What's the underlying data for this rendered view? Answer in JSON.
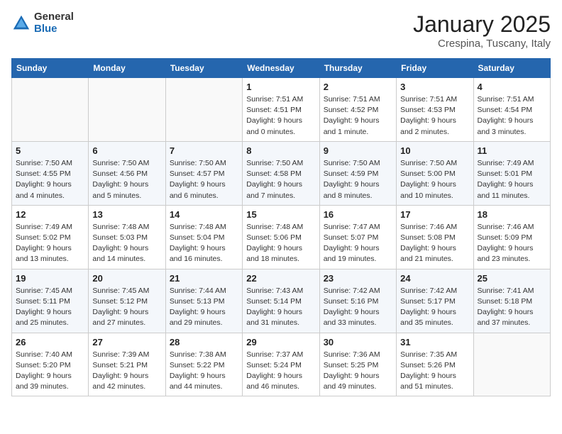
{
  "logo": {
    "general": "General",
    "blue": "Blue"
  },
  "title": "January 2025",
  "subtitle": "Crespina, Tuscany, Italy",
  "days_of_week": [
    "Sunday",
    "Monday",
    "Tuesday",
    "Wednesday",
    "Thursday",
    "Friday",
    "Saturday"
  ],
  "weeks": [
    [
      {
        "day": "",
        "info": ""
      },
      {
        "day": "",
        "info": ""
      },
      {
        "day": "",
        "info": ""
      },
      {
        "day": "1",
        "info": "Sunrise: 7:51 AM\nSunset: 4:51 PM\nDaylight: 9 hours\nand 0 minutes."
      },
      {
        "day": "2",
        "info": "Sunrise: 7:51 AM\nSunset: 4:52 PM\nDaylight: 9 hours\nand 1 minute."
      },
      {
        "day": "3",
        "info": "Sunrise: 7:51 AM\nSunset: 4:53 PM\nDaylight: 9 hours\nand 2 minutes."
      },
      {
        "day": "4",
        "info": "Sunrise: 7:51 AM\nSunset: 4:54 PM\nDaylight: 9 hours\nand 3 minutes."
      }
    ],
    [
      {
        "day": "5",
        "info": "Sunrise: 7:50 AM\nSunset: 4:55 PM\nDaylight: 9 hours\nand 4 minutes."
      },
      {
        "day": "6",
        "info": "Sunrise: 7:50 AM\nSunset: 4:56 PM\nDaylight: 9 hours\nand 5 minutes."
      },
      {
        "day": "7",
        "info": "Sunrise: 7:50 AM\nSunset: 4:57 PM\nDaylight: 9 hours\nand 6 minutes."
      },
      {
        "day": "8",
        "info": "Sunrise: 7:50 AM\nSunset: 4:58 PM\nDaylight: 9 hours\nand 7 minutes."
      },
      {
        "day": "9",
        "info": "Sunrise: 7:50 AM\nSunset: 4:59 PM\nDaylight: 9 hours\nand 8 minutes."
      },
      {
        "day": "10",
        "info": "Sunrise: 7:50 AM\nSunset: 5:00 PM\nDaylight: 9 hours\nand 10 minutes."
      },
      {
        "day": "11",
        "info": "Sunrise: 7:49 AM\nSunset: 5:01 PM\nDaylight: 9 hours\nand 11 minutes."
      }
    ],
    [
      {
        "day": "12",
        "info": "Sunrise: 7:49 AM\nSunset: 5:02 PM\nDaylight: 9 hours\nand 13 minutes."
      },
      {
        "day": "13",
        "info": "Sunrise: 7:48 AM\nSunset: 5:03 PM\nDaylight: 9 hours\nand 14 minutes."
      },
      {
        "day": "14",
        "info": "Sunrise: 7:48 AM\nSunset: 5:04 PM\nDaylight: 9 hours\nand 16 minutes."
      },
      {
        "day": "15",
        "info": "Sunrise: 7:48 AM\nSunset: 5:06 PM\nDaylight: 9 hours\nand 18 minutes."
      },
      {
        "day": "16",
        "info": "Sunrise: 7:47 AM\nSunset: 5:07 PM\nDaylight: 9 hours\nand 19 minutes."
      },
      {
        "day": "17",
        "info": "Sunrise: 7:46 AM\nSunset: 5:08 PM\nDaylight: 9 hours\nand 21 minutes."
      },
      {
        "day": "18",
        "info": "Sunrise: 7:46 AM\nSunset: 5:09 PM\nDaylight: 9 hours\nand 23 minutes."
      }
    ],
    [
      {
        "day": "19",
        "info": "Sunrise: 7:45 AM\nSunset: 5:11 PM\nDaylight: 9 hours\nand 25 minutes."
      },
      {
        "day": "20",
        "info": "Sunrise: 7:45 AM\nSunset: 5:12 PM\nDaylight: 9 hours\nand 27 minutes."
      },
      {
        "day": "21",
        "info": "Sunrise: 7:44 AM\nSunset: 5:13 PM\nDaylight: 9 hours\nand 29 minutes."
      },
      {
        "day": "22",
        "info": "Sunrise: 7:43 AM\nSunset: 5:14 PM\nDaylight: 9 hours\nand 31 minutes."
      },
      {
        "day": "23",
        "info": "Sunrise: 7:42 AM\nSunset: 5:16 PM\nDaylight: 9 hours\nand 33 minutes."
      },
      {
        "day": "24",
        "info": "Sunrise: 7:42 AM\nSunset: 5:17 PM\nDaylight: 9 hours\nand 35 minutes."
      },
      {
        "day": "25",
        "info": "Sunrise: 7:41 AM\nSunset: 5:18 PM\nDaylight: 9 hours\nand 37 minutes."
      }
    ],
    [
      {
        "day": "26",
        "info": "Sunrise: 7:40 AM\nSunset: 5:20 PM\nDaylight: 9 hours\nand 39 minutes."
      },
      {
        "day": "27",
        "info": "Sunrise: 7:39 AM\nSunset: 5:21 PM\nDaylight: 9 hours\nand 42 minutes."
      },
      {
        "day": "28",
        "info": "Sunrise: 7:38 AM\nSunset: 5:22 PM\nDaylight: 9 hours\nand 44 minutes."
      },
      {
        "day": "29",
        "info": "Sunrise: 7:37 AM\nSunset: 5:24 PM\nDaylight: 9 hours\nand 46 minutes."
      },
      {
        "day": "30",
        "info": "Sunrise: 7:36 AM\nSunset: 5:25 PM\nDaylight: 9 hours\nand 49 minutes."
      },
      {
        "day": "31",
        "info": "Sunrise: 7:35 AM\nSunset: 5:26 PM\nDaylight: 9 hours\nand 51 minutes."
      },
      {
        "day": "",
        "info": ""
      }
    ]
  ]
}
